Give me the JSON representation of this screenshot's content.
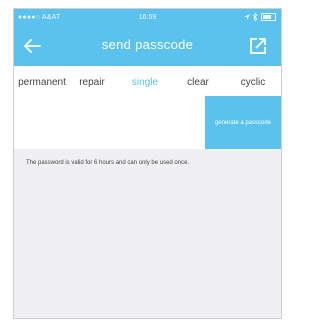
{
  "status_bar": {
    "carrier": "●●●●○ A&AT",
    "time": "16:59"
  },
  "header": {
    "title": "send passcode",
    "back_icon": "arrow-left-icon",
    "share_icon": "share-icon"
  },
  "tabs": [
    {
      "label": "permanent",
      "active": false
    },
    {
      "label": "repair",
      "active": false
    },
    {
      "label": "single",
      "active": true
    },
    {
      "label": "clear",
      "active": false
    },
    {
      "label": "cyclic",
      "active": false
    }
  ],
  "passcode": {
    "button_label": "generate a passcode"
  },
  "note": "The password is valid for 6 hours and can only be used once.",
  "colors": {
    "accent": "#5bc2ee",
    "background": "#f0f0f2"
  }
}
